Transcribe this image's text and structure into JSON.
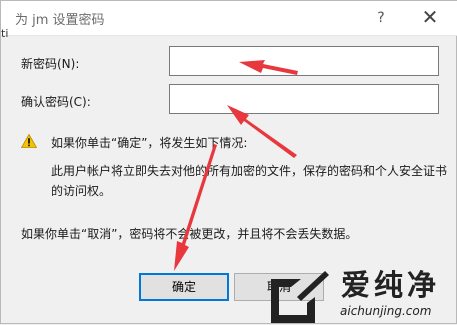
{
  "window": {
    "title": "为 jm 设置密码",
    "help_symbol": "?",
    "close_symbol": "✕",
    "side_char": "ti"
  },
  "form": {
    "new_password_label": "新密码(N):",
    "new_password_value": "",
    "confirm_password_label": "确认密码(C):",
    "confirm_password_value": ""
  },
  "warning": {
    "icon": "warning-icon",
    "title": "如果你单击“确定”，将发生如下情况:",
    "body": "此用户帐户将立即失去对他的所有加密的文件，保存的密码和个人安全证书的访问权。"
  },
  "cancel_note": "如果你单击“取消”，密码将不会被更改，并且将不会丢失数据。",
  "buttons": {
    "ok_label": "确定",
    "cancel_label": "取消"
  },
  "annotation": {
    "arrow_color": "#e8383d"
  },
  "watermark": {
    "brand_cn": "爱纯净",
    "url": "aichunjing.com"
  }
}
